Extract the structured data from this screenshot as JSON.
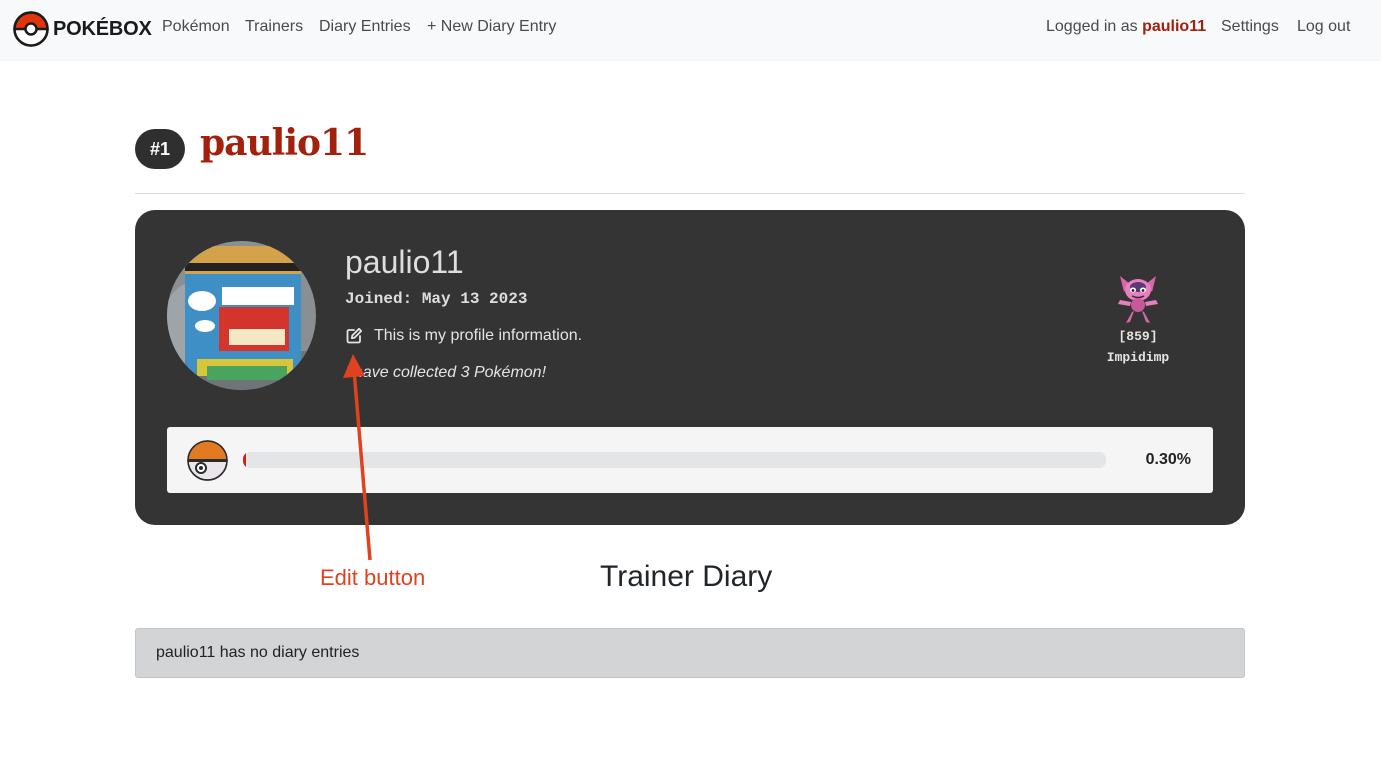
{
  "navbar": {
    "brand": "POKÉBOX",
    "links": [
      "Pokémon",
      "Trainers",
      "Diary Entries",
      "+ New Diary Entry"
    ],
    "logged_in_prefix": "Logged in as",
    "logged_in_user": "paulio11",
    "settings": "Settings",
    "logout": "Log out"
  },
  "profile": {
    "rank": "#1",
    "title": "paulio11",
    "name": "paulio11",
    "joined": "Joined: May 13 2023",
    "bio": "This is my profile information.",
    "collected": "I have collected 3 Pokémon!",
    "favorite": {
      "number": "[859]",
      "name": "Impidimp"
    },
    "progress": {
      "percent_label": "0.30%",
      "fraction": 0.003
    }
  },
  "annotation": {
    "label": "Edit button",
    "color": "#e0411f"
  },
  "diary": {
    "heading": "Trainer Diary",
    "empty_message": "paulio11 has no diary entries"
  },
  "colors": {
    "accent": "#a3200d",
    "card_bg": "#343434",
    "progress_fill": "#c6251a"
  }
}
